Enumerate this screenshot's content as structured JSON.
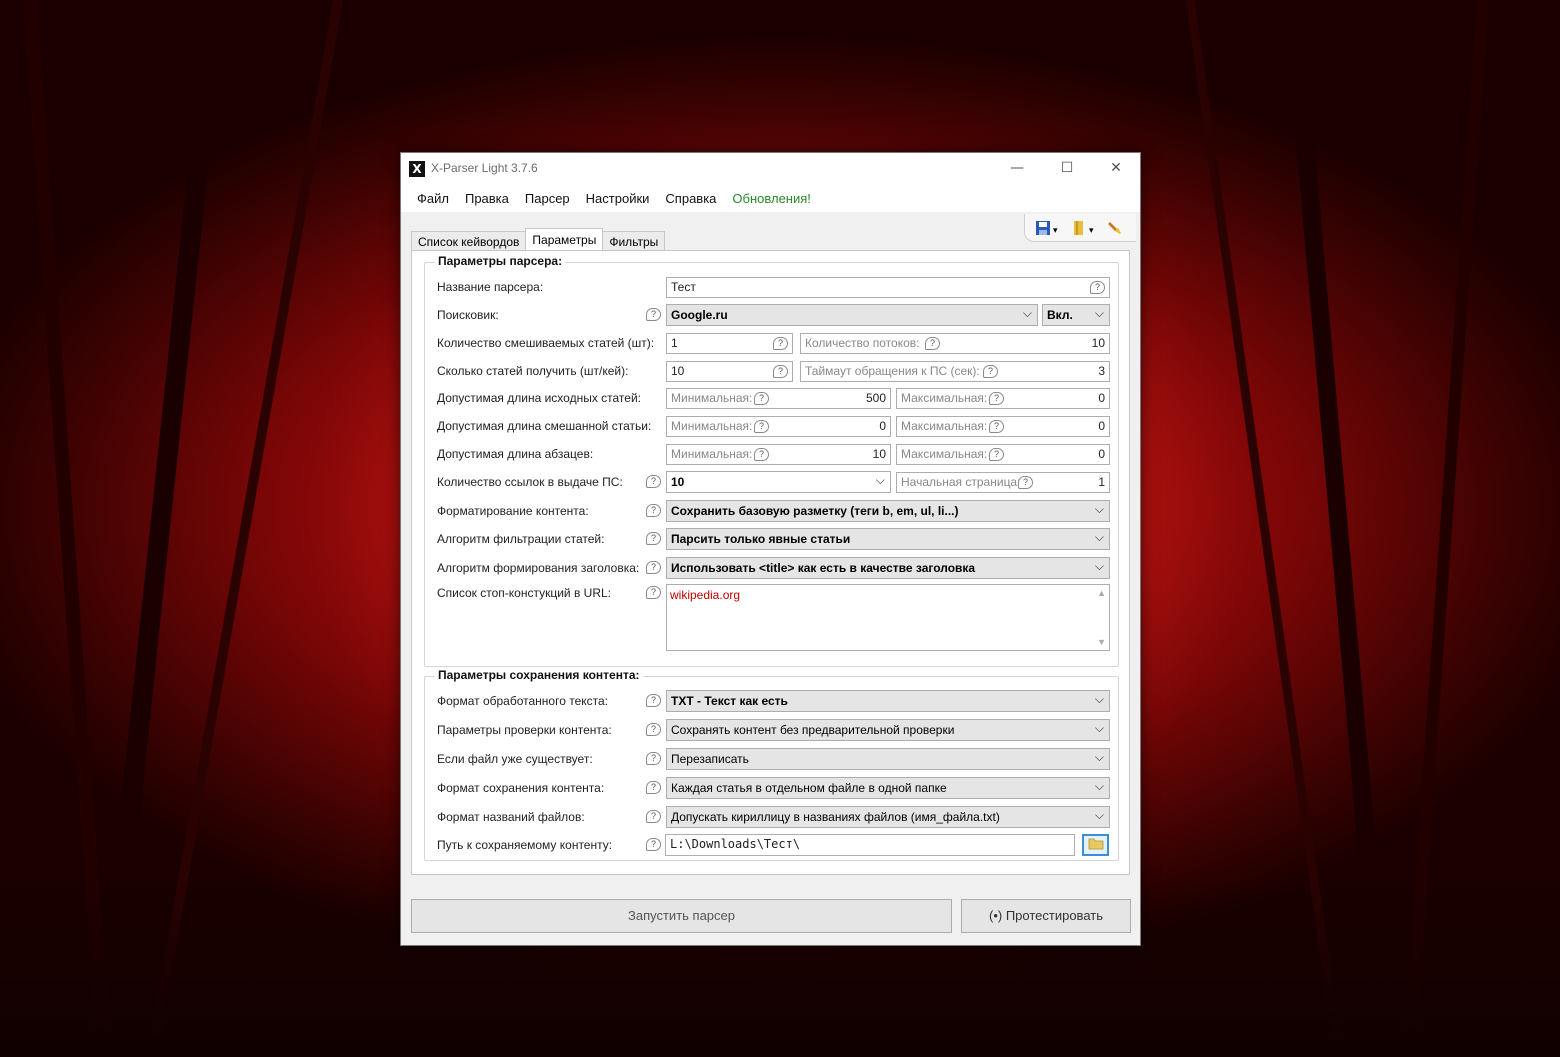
{
  "window": {
    "title": "X-Parser Light 3.7.6",
    "icon_letter": "X",
    "controls": {
      "minimize": "—",
      "maximize": "☐",
      "close": "✕"
    }
  },
  "menu": {
    "items": [
      "Файл",
      "Правка",
      "Парсер",
      "Настройки",
      "Справка"
    ],
    "update": "Обновления!"
  },
  "toolbar": {
    "icons": [
      "save-icon",
      "bookmark-icon",
      "brush-icon"
    ],
    "dropdown_arrow": "▾"
  },
  "tabs": [
    "Список кейвордов",
    "Параметры",
    "Фильтры"
  ],
  "active_tab": "Параметры",
  "help_glyph": "?",
  "combo_arrow": "⌵",
  "parser_group": {
    "legend": "Параметры парсера:",
    "name_label": "Название парсера:",
    "name_value": "Тест",
    "engine_label": "Поисковик:",
    "engine_value": "Google.ru",
    "engine_state": "Вкл.",
    "mix_count_label": "Количество смешиваемых статей (шт):",
    "mix_count_value": "1",
    "threads_label": "Количество потоков:",
    "threads_value": "10",
    "articles_per_key_label": "Сколько статей получить (шт/кей):",
    "articles_per_key_value": "10",
    "timeout_label": "Таймаут обращения к ПС (сек):",
    "timeout_value": "3",
    "src_len_label": "Допустимая длина исходных статей:",
    "src_len_min_label": "Минимальная:",
    "src_len_min": "500",
    "src_len_max_label": "Максимальная:",
    "src_len_max": "0",
    "mix_len_label": "Допустимая длина смешанной статьи:",
    "mix_len_min_label": "Минимальная:",
    "mix_len_min": "0",
    "mix_len_max_label": "Максимальная:",
    "mix_len_max": "0",
    "para_len_label": "Допустимая длина абзацев:",
    "para_len_min_label": "Минимальная:",
    "para_len_min": "10",
    "para_len_max_label": "Максимальная:",
    "para_len_max": "0",
    "links_label": "Количество ссылок в выдаче ПС:",
    "links_value": "10",
    "start_page_label": "Начальная страница:",
    "start_page_value": "1",
    "format_label": "Форматирование контента:",
    "format_value": "Сохранить базовую разметку (теги b, em, ul, li...)",
    "filter_algo_label": "Алгоритм фильтрации статей:",
    "filter_algo_value": "Парсить только явные статьи",
    "title_algo_label": "Алгоритм формирования заголовка:",
    "title_algo_value": "Использовать <title> как есть в качестве заголовка",
    "stop_url_label": "Список стоп-констукций в URL:",
    "stop_url_value": "wikipedia.org"
  },
  "save_group": {
    "legend": "Параметры сохранения контента:",
    "text_format_label": "Формат обработанного текста:",
    "text_format_value": "TXT - Текст как есть",
    "check_label": "Параметры проверки контента:",
    "check_value": "Сохранять контент без предварительной проверки",
    "exists_label": "Если файл уже существует:",
    "exists_value": "Перезаписать",
    "save_format_label": "Формат сохранения контента:",
    "save_format_value": "Каждая статья в отдельном файле в одной папке",
    "filename_label": "Формат названий файлов:",
    "filename_value": "Допускать кириллицу в названиях файлов (имя_файла.txt)",
    "path_label": "Путь к сохраняемому контенту:",
    "path_value": "L:\\Downloads\\Тест\\"
  },
  "buttons": {
    "start": "Запустить парсер",
    "test": "(•) Протестировать"
  }
}
